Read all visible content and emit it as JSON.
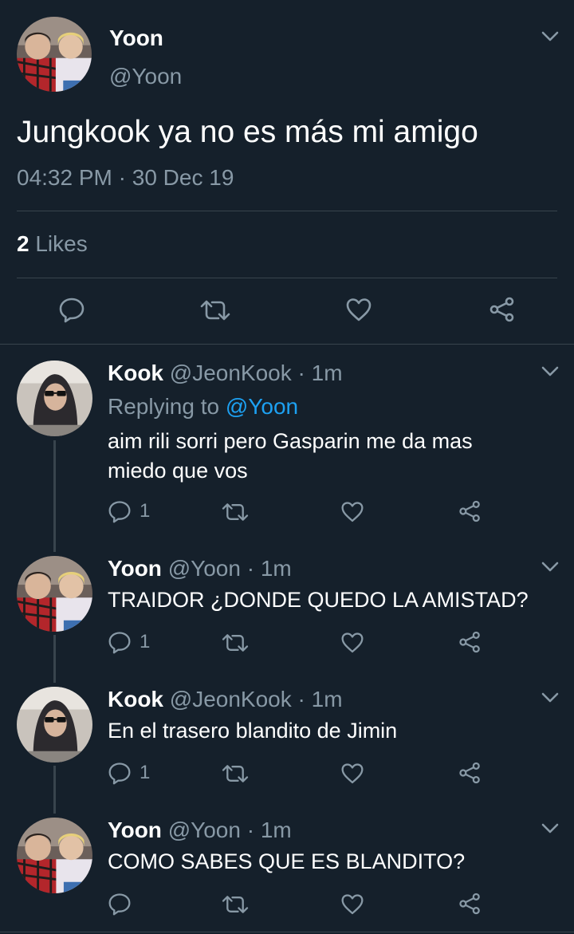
{
  "main_tweet": {
    "author_name": "Yoon",
    "author_handle": "@Yoon",
    "text": "Jungkook ya no es más mi amigo",
    "time": "04:32 PM",
    "date": "30 Dec 19",
    "likes_count": "2",
    "likes_label": "Likes"
  },
  "replies": [
    {
      "author_name": "Kook",
      "author_handle": "@JeonKook",
      "age": "1m",
      "replying_prefix": "Replying to",
      "replying_to": "@Yoon",
      "text_line1": "aim rili sorri pero Gasparin me da mas",
      "text_line2": "miedo que vos",
      "reply_count": "1"
    },
    {
      "author_name": "Yoon",
      "author_handle": "@Yoon",
      "age": "1m",
      "text": "TRAIDOR ¿DONDE QUEDO LA AMISTAD?",
      "reply_count": "1"
    },
    {
      "author_name": "Kook",
      "author_handle": "@JeonKook",
      "age": "1m",
      "text": "En el trasero blandito de Jimin",
      "reply_count": "1"
    },
    {
      "author_name": "Yoon",
      "author_handle": "@Yoon",
      "age": "1m",
      "text": "COMO SABES QUE ES BLANDITO?",
      "reply_count": ""
    }
  ],
  "separator": "·",
  "colors": {
    "background": "#15202b",
    "muted": "#8899a6",
    "link": "#1da1f2",
    "divider": "#38444d"
  },
  "icons": [
    "chevron-down-icon",
    "reply-icon",
    "retweet-icon",
    "like-icon",
    "share-icon"
  ]
}
